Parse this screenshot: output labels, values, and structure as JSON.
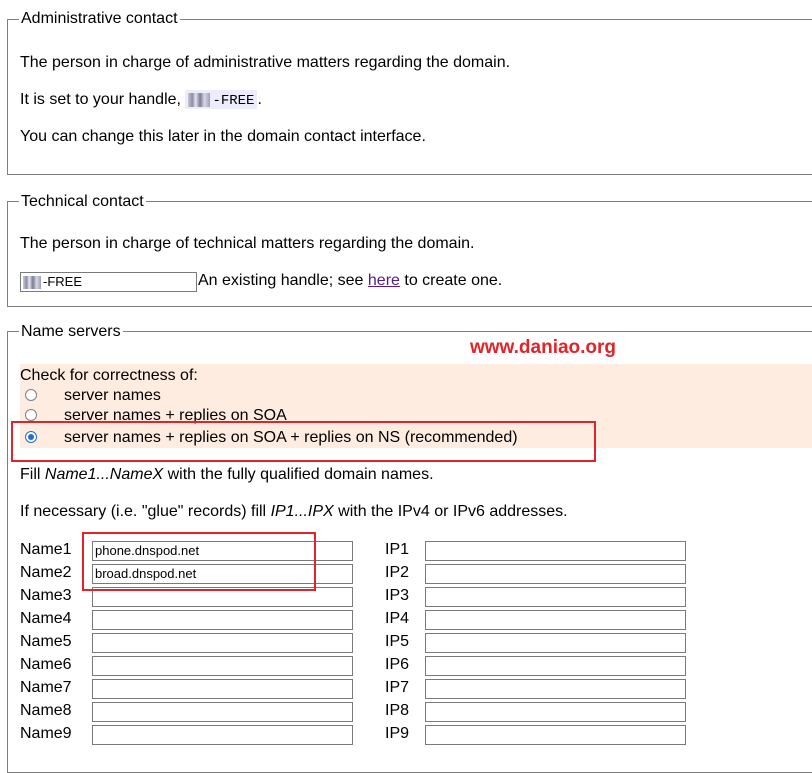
{
  "admin": {
    "legend": "Administrative contact",
    "line1": "The person in charge of administrative matters regarding the domain.",
    "line2_prefix": "It is set to your handle,",
    "handle_suffix": "-FREE",
    "line2_end": ".",
    "line3": "You can change this later in the domain contact interface."
  },
  "technical": {
    "legend": "Technical contact",
    "line1": "The person in charge of technical matters regarding the domain.",
    "handle_value_suffix": "-FREE",
    "hint_prefix": "An existing handle; see",
    "link_text": "here",
    "hint_suffix": "to create one."
  },
  "nameservers": {
    "legend": "Name servers",
    "check_title": "Check for correctness of:",
    "options": [
      {
        "label": "server names",
        "selected": false
      },
      {
        "label": "server names + replies on SOA",
        "selected": false
      },
      {
        "label": "server names + replies on SOA + replies on NS (recommended)",
        "selected": true
      }
    ],
    "fill_line": {
      "pre": "Fill ",
      "em": "Name1...NameX",
      "post": " with the fully qualified domain names."
    },
    "glue_line": {
      "pre": "If necessary (i.e. \"glue\" records) fill ",
      "em": "IP1...IPX",
      "post": " with the IPv4 or IPv6 addresses."
    },
    "rows": [
      {
        "name_label": "Name1",
        "name_value": "phone.dnspod.net",
        "ip_label": "IP1",
        "ip_value": ""
      },
      {
        "name_label": "Name2",
        "name_value": "broad.dnspod.net",
        "ip_label": "IP2",
        "ip_value": ""
      },
      {
        "name_label": "Name3",
        "name_value": "",
        "ip_label": "IP3",
        "ip_value": ""
      },
      {
        "name_label": "Name4",
        "name_value": "",
        "ip_label": "IP4",
        "ip_value": ""
      },
      {
        "name_label": "Name5",
        "name_value": "",
        "ip_label": "IP5",
        "ip_value": ""
      },
      {
        "name_label": "Name6",
        "name_value": "",
        "ip_label": "IP6",
        "ip_value": ""
      },
      {
        "name_label": "Name7",
        "name_value": "",
        "ip_label": "IP7",
        "ip_value": ""
      },
      {
        "name_label": "Name8",
        "name_value": "",
        "ip_label": "IP8",
        "ip_value": ""
      },
      {
        "name_label": "Name9",
        "name_value": "",
        "ip_label": "IP9",
        "ip_value": ""
      }
    ]
  },
  "watermark": "www.daniao.org",
  "colors": {
    "accent_red": "#e0242a",
    "highlight": "#ffece0",
    "radio_blue": "#1f6fd1",
    "link": "#551a8b"
  }
}
